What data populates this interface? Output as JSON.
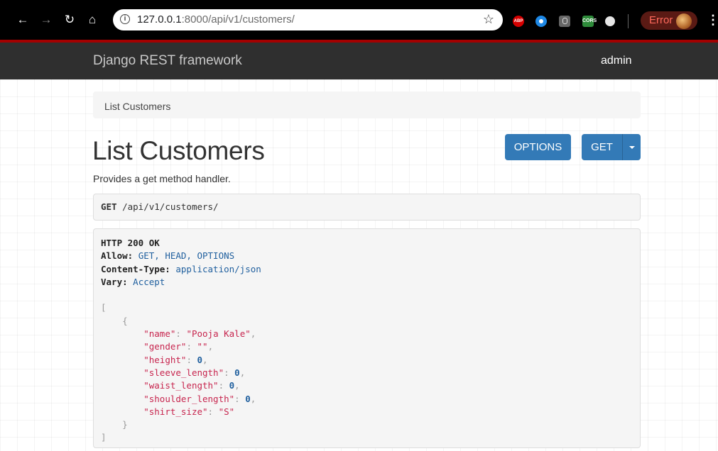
{
  "browser": {
    "url_host": "127.0.0.1",
    "url_rest": ":8000/api/v1/customers/",
    "error_label": "Error",
    "extensions": [
      "ABP",
      "CORS"
    ]
  },
  "navbar": {
    "brand": "Django REST framework",
    "user": "admin"
  },
  "breadcrumb": "List Customers",
  "page": {
    "title": "List Customers",
    "description": "Provides a get method handler.",
    "options_button": "OPTIONS",
    "get_button": "GET"
  },
  "request": {
    "method": "GET",
    "path": "/api/v1/customers/"
  },
  "response": {
    "status": "HTTP 200 OK",
    "headers": [
      {
        "key": "Allow:",
        "value": "GET, HEAD, OPTIONS"
      },
      {
        "key": "Content-Type:",
        "value": "application/json"
      },
      {
        "key": "Vary:",
        "value": "Accept"
      }
    ],
    "body": {
      "open_bracket": "[",
      "open_brace": "{",
      "fields": [
        {
          "key": "\"name\"",
          "value": "\"Pooja Kale\"",
          "type": "str"
        },
        {
          "key": "\"gender\"",
          "value": "\"\"",
          "type": "str"
        },
        {
          "key": "\"height\"",
          "value": "0",
          "type": "num"
        },
        {
          "key": "\"sleeve_length\"",
          "value": "0",
          "type": "num"
        },
        {
          "key": "\"waist_length\"",
          "value": "0",
          "type": "num"
        },
        {
          "key": "\"shoulder_length\"",
          "value": "0",
          "type": "num"
        },
        {
          "key": "\"shirt_size\"",
          "value": "\"S\"",
          "type": "str"
        }
      ],
      "close_brace": "}",
      "close_bracket": "]"
    }
  }
}
